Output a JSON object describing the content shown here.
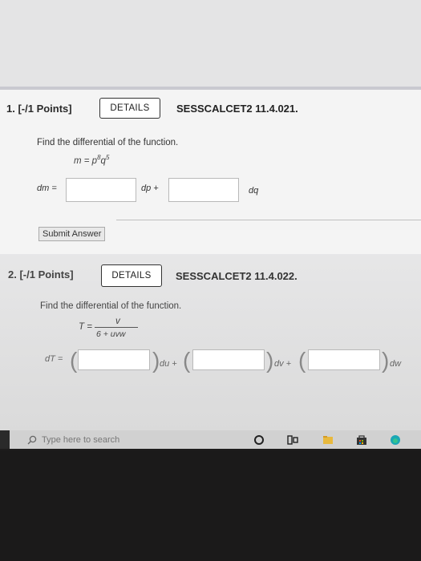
{
  "q1": {
    "number": "1. [-/1 Points]",
    "details_label": "DETAILS",
    "code": "SESSCALCET2 11.4.021.",
    "prompt": "Find the differential of the function.",
    "formula_lhs": "m = p",
    "formula_exp_p": "8",
    "formula_q": "q",
    "formula_exp_q": "5",
    "dm_label": "dm =",
    "dp_label": "dp +",
    "dq_label": "dq",
    "submit_label": "Submit Answer"
  },
  "q2": {
    "number": "2. [-/1 Points]",
    "details_label": "DETAILS",
    "code": "SESSCALCET2 11.4.022.",
    "prompt": "Find the differential of the function.",
    "formula_lhs": "T =",
    "formula_numerator": "v",
    "formula_denominator": "6 + uvw",
    "dT_label": "dT =",
    "du_label": "du +",
    "dv_label": "dv +",
    "dw_label": "dw"
  },
  "taskbar": {
    "search_placeholder": "Type here to search"
  }
}
